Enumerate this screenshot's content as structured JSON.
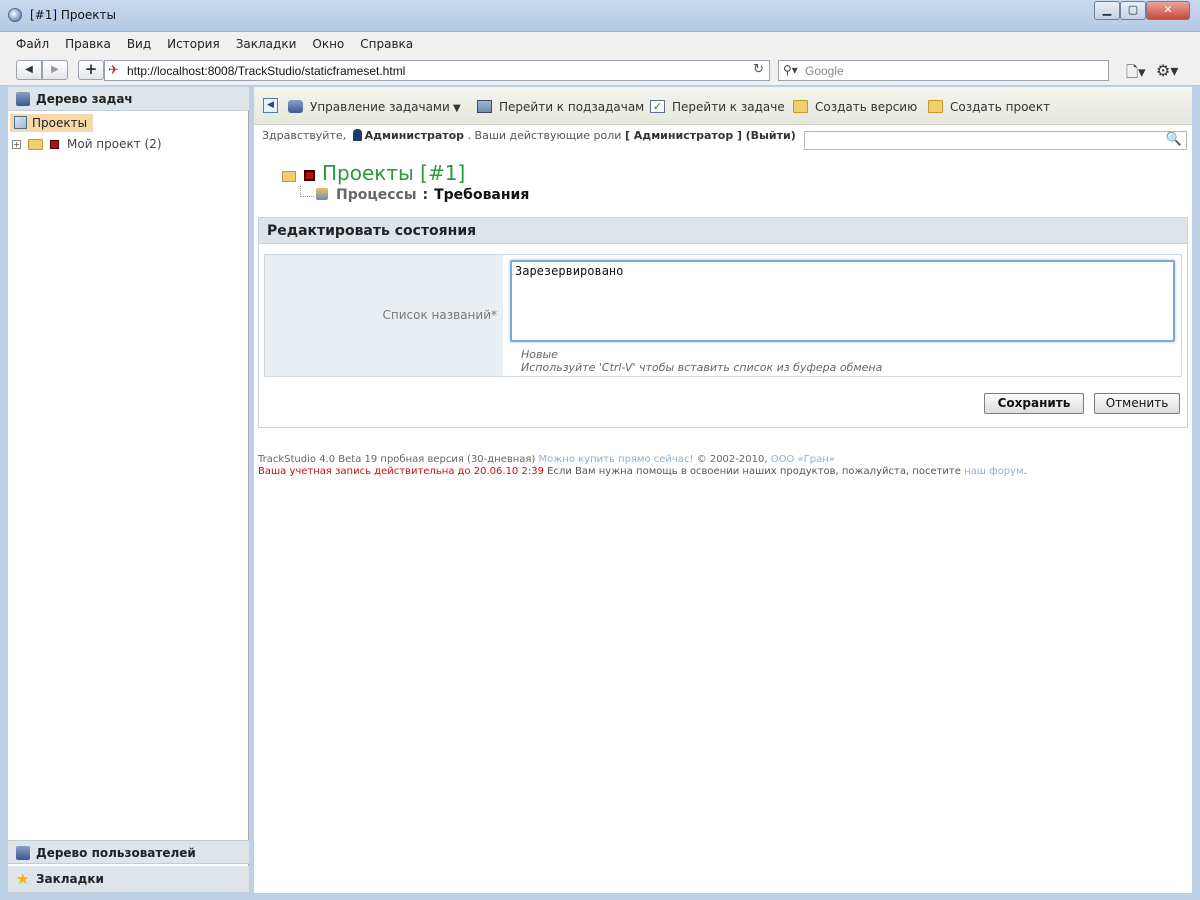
{
  "window": {
    "title": "[#1] Проекты",
    "min_label": "▁",
    "max_label": "▢",
    "close_label": "✕"
  },
  "menu": [
    "Файл",
    "Правка",
    "Вид",
    "История",
    "Закладки",
    "Окно",
    "Справка"
  ],
  "nav": {
    "url": "http://localhost:8008/TrackStudio/staticframeset.html",
    "search_placeholder": "Google"
  },
  "left": {
    "task_tree_title": "Дерево задач",
    "root_label": "Проекты",
    "project_item": "Мой проект (2)",
    "users_tree_title": "Дерево пользователей",
    "bookmarks_title": "Закладки"
  },
  "toolbar": {
    "manage_tasks": "Управление задачами",
    "goto_subtasks": "Перейти к подзадачам",
    "goto_task": "Перейти к задаче",
    "create_version": "Создать версию",
    "create_project": "Создать проект"
  },
  "greeting": {
    "hello": "Здравствуйте,",
    "user": "Администратор",
    "roles_text": ". Ваши действующие роли",
    "roles_value": "[ Администратор ]",
    "logout": "(Выйти)"
  },
  "breadcrumb": {
    "title": "Проекты  [#1]",
    "processes": "Процессы",
    "separator": ":",
    "requirements": "Требования"
  },
  "form": {
    "heading": "Редактировать состояния",
    "label": "Список названий*",
    "value": "Зарезервировано",
    "hint_line1": "Новые",
    "hint_line2": "Используйте 'Ctrl-V' чтобы вставить список из буфера обмена",
    "save": "Сохранить",
    "cancel": "Отменить"
  },
  "footer": {
    "product": "TrackStudio 4.0 Beta 19 пробная версия (30-дневная)",
    "buy_link": "Можно купить прямо сейчас!",
    "copyright": "© 2002-2010,",
    "company_link": "ООО «Гран»",
    "account_warning": "Ваша учетная запись действительна до 20.06.10 2:39",
    "help_text": "Если Вам нужна помощь в освоении наших продуктов, пожалуйста, посетите",
    "forum_link": "наш форум",
    "period": "."
  }
}
